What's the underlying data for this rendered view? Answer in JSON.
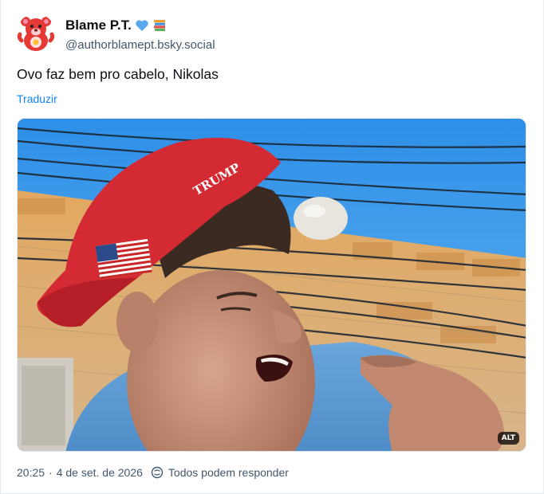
{
  "post": {
    "author": {
      "display_name": "Blame P.T.",
      "handle": "@authorblamept.bsky.social",
      "name_emojis": [
        "blue-heart-icon",
        "books-icon"
      ]
    },
    "text": "Ovo faz bem pro cabelo, Nikolas",
    "translate_label": "Traduzir",
    "media": {
      "alt_badge": "ALT",
      "image_subject": "video-frame"
    },
    "meta": {
      "time": "20:25",
      "separator": "·",
      "date": "4 de set. de 2026",
      "reply_setting": "Todos podem responder"
    }
  },
  "colors": {
    "accent": "#1083fe",
    "text_primary": "#0b0f14",
    "text_secondary": "#42576c",
    "border": "#e6ebf0"
  }
}
